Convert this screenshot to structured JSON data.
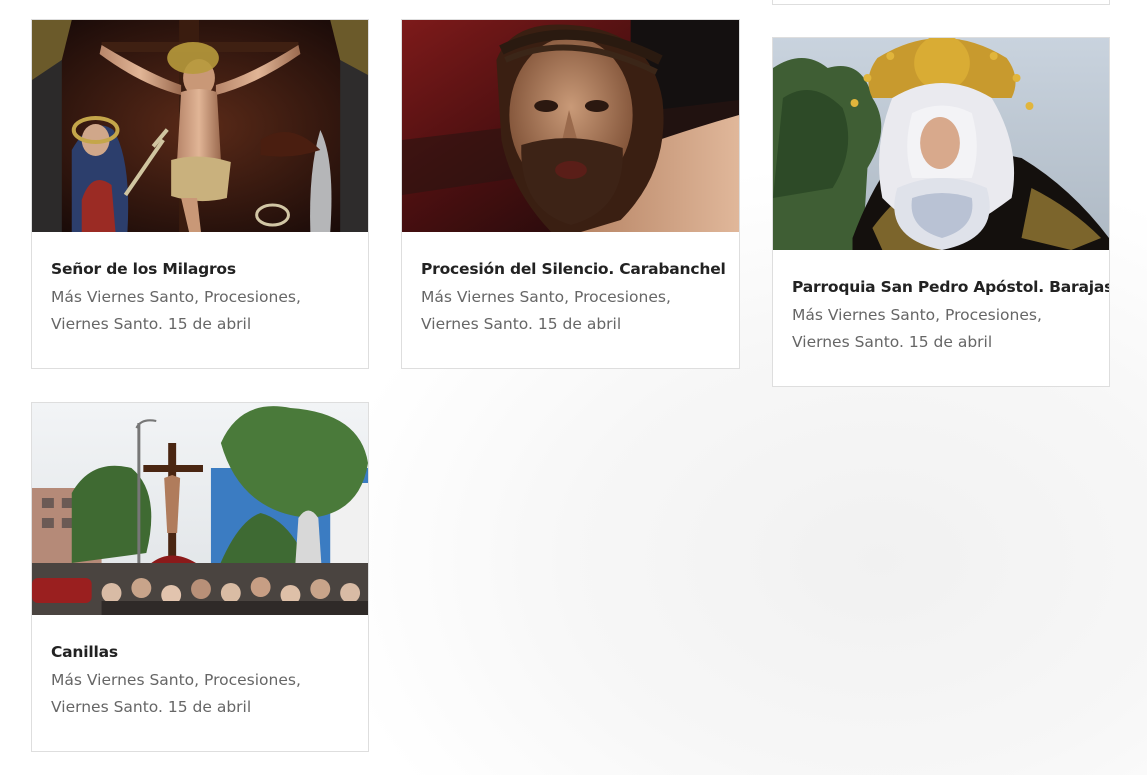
{
  "cards": [
    {
      "title": "Señor de los Milagros",
      "categories": [
        "Más Viernes Santo",
        "Procesiones"
      ],
      "date": "Viernes Santo. 15 de abril",
      "image_icon": "crucifix-painting-image"
    },
    {
      "title": "Procesión del Silencio. Carabanchel",
      "categories": [
        "Más Viernes Santo",
        "Procesiones"
      ],
      "date": "Viernes Santo. 15 de abril",
      "image_icon": "christ-face-image"
    },
    {
      "title": "Parroquia San Pedro Apóstol. Barajas",
      "categories": [
        "Más Viernes Santo",
        "Procesiones"
      ],
      "date": "Viernes Santo. 15 de abril",
      "image_icon": "virgin-statue-image"
    },
    {
      "title": "Canillas",
      "categories": [
        "Más Viernes Santo",
        "Procesiones"
      ],
      "date": "Viernes Santo. 15 de abril",
      "image_icon": "street-procession-image"
    }
  ],
  "separator": ", ",
  "trailing": ","
}
